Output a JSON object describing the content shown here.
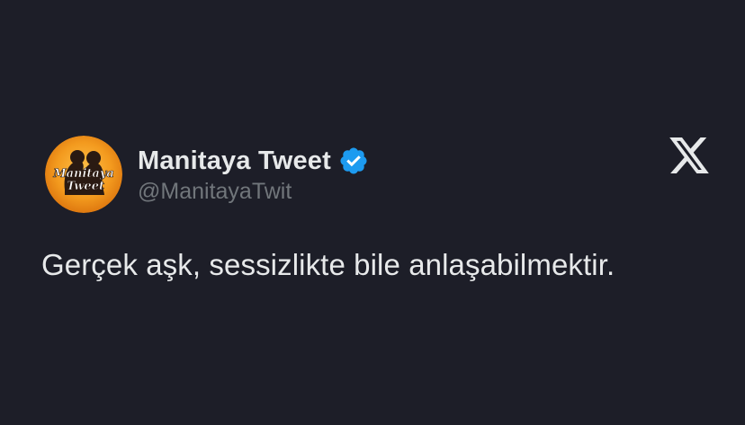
{
  "tweet": {
    "avatar_text_line1": "Manitaya",
    "avatar_text_line2": "Tweet",
    "display_name": "Manitaya Tweet",
    "handle": "@ManitayaTwit",
    "text": "Gerçek aşk, sessizlikte bile anlaşabilmektir.",
    "verified_icon": "verified-badge-icon",
    "brand_icon": "x-logo-icon"
  },
  "colors": {
    "background": "#1d1e28",
    "text_primary": "#e7e9ea",
    "text_secondary": "#71767b",
    "verified_blue": "#1d9bf0",
    "avatar_orange": "#f39a1e"
  }
}
